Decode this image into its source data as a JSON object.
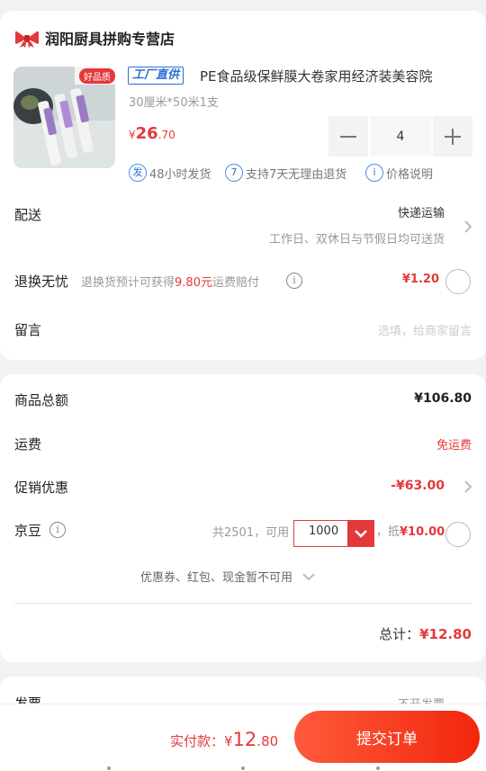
{
  "store": {
    "name": "润阳厨具拼购专营店"
  },
  "product": {
    "tag": "工厂直供",
    "thumb_badge": "好品质",
    "title": "PE食品级保鲜膜大卷家用经济装美容院",
    "spec": "30厘米*50米1支",
    "price_currency": "¥",
    "price_int": "26",
    "price_dec": ".70",
    "quantity": "4"
  },
  "services": [
    {
      "icon": "发",
      "label": "48小时发货"
    },
    {
      "icon": "7",
      "label": "支持7天无理由退货"
    },
    {
      "icon": "i",
      "label": "价格说明"
    }
  ],
  "delivery": {
    "label": "配送",
    "method": "快递运输",
    "note": "工作日、双休日与节假日均可送货"
  },
  "return_insurance": {
    "label": "退换无忧",
    "desc_prefix": "退换货预计可获得",
    "desc_amount": "9.80元",
    "desc_suffix": "运费赔付",
    "price": "¥1.20"
  },
  "message": {
    "label": "留言",
    "placeholder": "选填，给商家留言"
  },
  "summary": {
    "goods_total_label": "商品总额",
    "goods_total": "¥106.80",
    "shipping_label": "运费",
    "shipping": "免运费",
    "promo_label": "促销优惠",
    "promo": "-¥63.00",
    "bean_label": "京豆",
    "bean_prefix": "共2501，可用",
    "bean_value": "1000",
    "bean_deduct_prefix": "，抵",
    "bean_deduct": "¥10.00",
    "coupon_note": "优惠券、红包、现金暂不可用",
    "total_label": "总计：",
    "total": "¥12.80"
  },
  "invoice": {
    "label": "发票",
    "value": "不开发票"
  },
  "footer": {
    "pay_label": "实付款：",
    "pay_currency": "¥",
    "pay_int": "12",
    "pay_dec": ".80",
    "submit_label": "提交订单"
  },
  "colors": {
    "accent": "#e4393c",
    "info_blue": "#2b6fd6"
  }
}
